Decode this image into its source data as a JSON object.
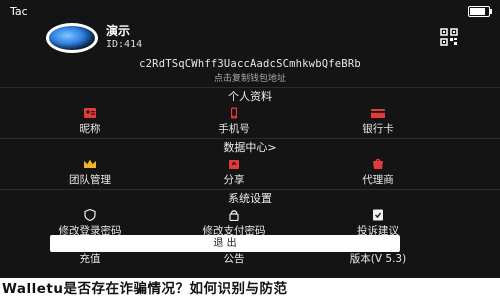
{
  "statusbar": {
    "app_name": "Tac",
    "battery_level": 0.85
  },
  "profile": {
    "name": "演示",
    "id": "ID:414",
    "avatar_icon": "planet-avatar-icon",
    "qr_icon": "qr-code-icon"
  },
  "wallet": {
    "address": "c2RdTSqCWhff3UaccAadcSCmhkwbQfeBRb",
    "hint": "点击复制钱包地址"
  },
  "sections": {
    "personal": {
      "title": "个人资料",
      "items": [
        {
          "label": "昵称",
          "icon": "id-card-icon",
          "color": "#e23b3b"
        },
        {
          "label": "手机号",
          "icon": "phone-icon",
          "color": "#e23b3b"
        },
        {
          "label": "银行卡",
          "icon": "card-icon",
          "color": "#e23b3b"
        }
      ]
    },
    "data": {
      "title": "数据中心>",
      "items": [
        {
          "label": "团队管理",
          "icon": "crown-icon",
          "color": "#f0b429"
        },
        {
          "label": "分享",
          "icon": "share-icon",
          "color": "#e23b3b"
        },
        {
          "label": "代理商",
          "icon": "agent-icon",
          "color": "#e23b3b"
        }
      ]
    },
    "settings": {
      "title": "系统设置",
      "items": [
        {
          "label": "修改登录密码",
          "icon": "shield-icon",
          "color": "#f0f0f0"
        },
        {
          "label": "修改支付密码",
          "icon": "lock-icon",
          "color": "#f0f0f0"
        },
        {
          "label": "投诉建议",
          "icon": "feedback-icon",
          "color": "#f0f0f0"
        },
        {
          "label": "充值",
          "icon": "recharge-icon",
          "color": "#e23b3b"
        },
        {
          "label": "公告",
          "icon": "notice-icon",
          "color": "#e23b3b"
        },
        {
          "label": "版本(V 5.3)",
          "icon": "version-icon",
          "color": "#e23b3b"
        }
      ]
    }
  },
  "logout_label": "退  出",
  "footer_title": "Walletu是否存在诈骗情况？如何识别与防范"
}
